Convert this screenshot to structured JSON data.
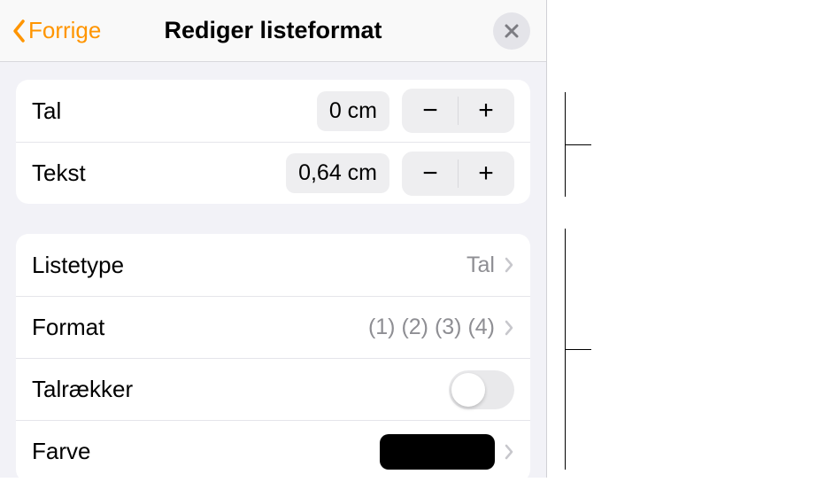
{
  "header": {
    "back_label": "Forrige",
    "title": "Rediger listeformat"
  },
  "indent": {
    "tal_label": "Tal",
    "tal_value": "0 cm",
    "tekst_label": "Tekst",
    "tekst_value": "0,64 cm"
  },
  "list": {
    "listetype_label": "Listetype",
    "listetype_value": "Tal",
    "format_label": "Format",
    "format_value": "(1) (2) (3) (4)",
    "talraekker_label": "Talrækker",
    "talraekker_on": false,
    "farve_label": "Farve",
    "farve_value": "#000000"
  }
}
